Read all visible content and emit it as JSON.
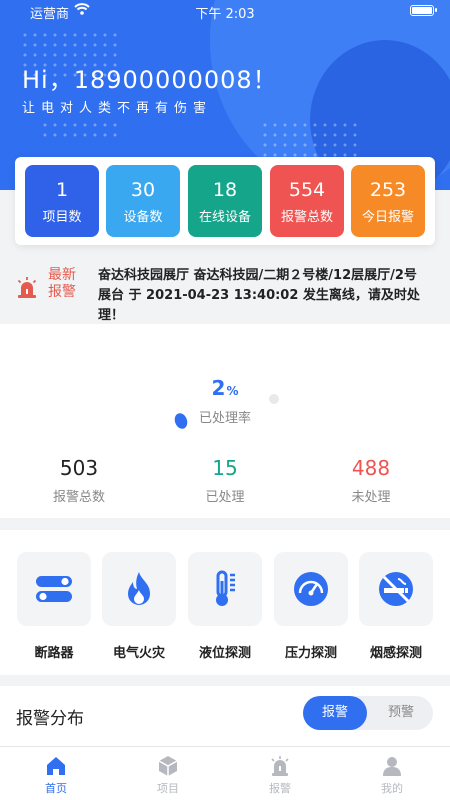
{
  "status_bar": {
    "carrier": "运营商",
    "time": "下午 2:03"
  },
  "header": {
    "greeting": "Hi，18900000008！",
    "slogan": "让电对人类不再有伤害"
  },
  "stats": [
    {
      "value": "1",
      "label": "项目数",
      "color": "#2f62e8"
    },
    {
      "value": "30",
      "label": "设备数",
      "color": "#3aa8f0"
    },
    {
      "value": "18",
      "label": "在线设备",
      "color": "#15a58a"
    },
    {
      "value": "554",
      "label": "报警总数",
      "color": "#ef5452"
    },
    {
      "value": "253",
      "label": "今日报警",
      "color": "#f68a26"
    }
  ],
  "latest_alarm": {
    "tag_line1": "最新",
    "tag_line2": "报警",
    "message": "奋达科技园展厅 奋达科技园/二期２号楼/12层展厅/2号展台 于 2021-04-23 13:40:02 发生离线，请及时处理！"
  },
  "processing": {
    "rate": "2",
    "rate_unit": "%",
    "rate_label": "已处理率",
    "rate_fraction": 0.02,
    "counts": [
      {
        "value": "503",
        "label": "报警总数",
        "color": "#222222"
      },
      {
        "value": "15",
        "label": "已处理",
        "color": "#15a58a"
      },
      {
        "value": "488",
        "label": "未处理",
        "color": "#ef5452"
      }
    ]
  },
  "categories": [
    {
      "label": "断路器",
      "icon": "circuit-breaker-icon"
    },
    {
      "label": "电气火灾",
      "icon": "flame-icon"
    },
    {
      "label": "液位探测",
      "icon": "thermometer-icon"
    },
    {
      "label": "压力探测",
      "icon": "pressure-gauge-icon"
    },
    {
      "label": "烟感探测",
      "icon": "no-smoking-icon"
    }
  ],
  "distribution": {
    "title": "报警分布",
    "tabs": [
      {
        "label": "报警",
        "active": true
      },
      {
        "label": "预警",
        "active": false
      }
    ]
  },
  "tabbar": [
    {
      "label": "首页",
      "icon": "home-icon",
      "active": true
    },
    {
      "label": "项目",
      "icon": "cube-icon",
      "active": false
    },
    {
      "label": "报警",
      "icon": "siren-icon",
      "active": false
    },
    {
      "label": "我的",
      "icon": "user-icon",
      "active": false
    }
  ],
  "colors": {
    "primary": "#2f6ff0",
    "danger": "#ef5452",
    "success": "#15a58a",
    "inactive": "#b5b8bf"
  }
}
